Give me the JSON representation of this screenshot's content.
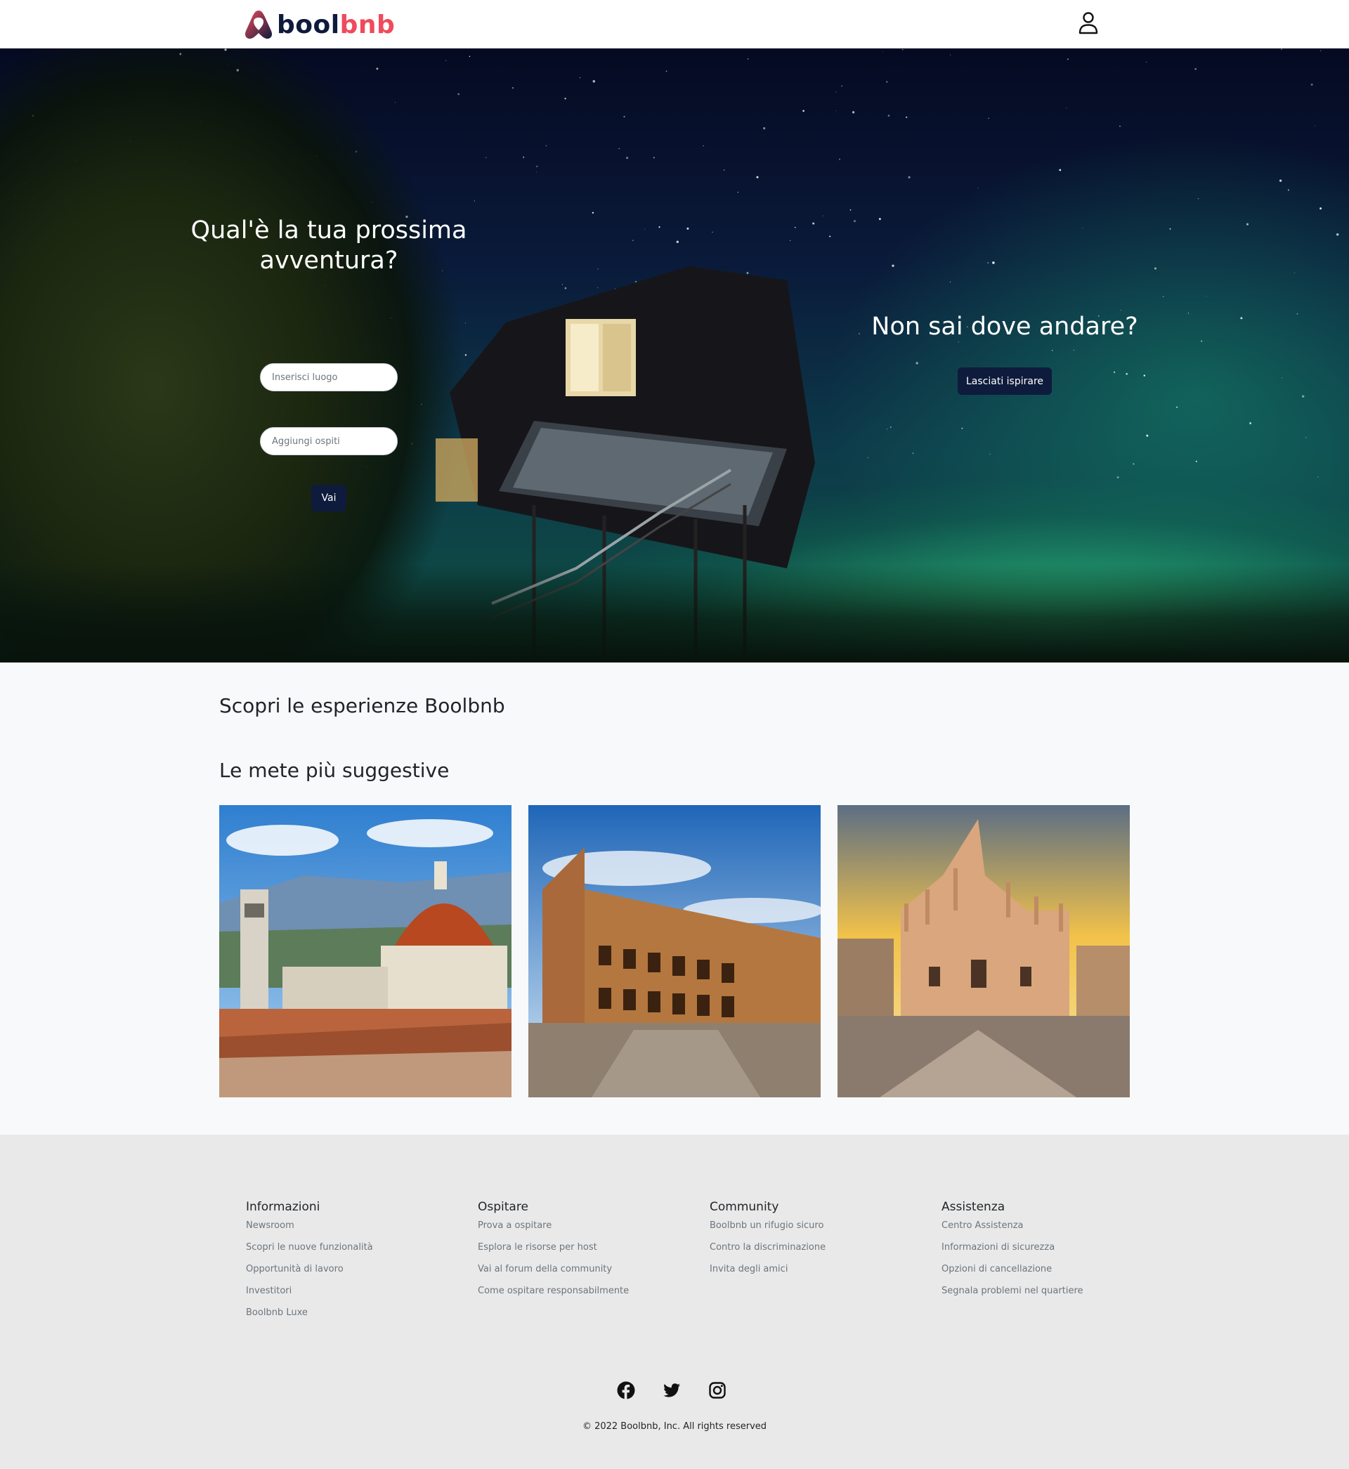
{
  "header": {
    "logo_text_dark": "bool",
    "logo_text_accent": "bnb",
    "user_icon": "user-icon"
  },
  "hero": {
    "title": "Qual'è la tua prossima avventura?",
    "place_placeholder": "Inserisci luogo",
    "guests_placeholder": "Aggiungi ospiti",
    "go_button": "Vai",
    "right_title": "Non sai dove andare?",
    "inspire_button": "Lasciati ispirare"
  },
  "main": {
    "experiences_title": "Scopri le esperienze Boolbnb",
    "destinations_title": "Le mete più suggestive",
    "cards": [
      {
        "image": "florence-duomo"
      },
      {
        "image": "rome-colosseum"
      },
      {
        "image": "milan-duomo"
      }
    ]
  },
  "footer": {
    "columns": [
      {
        "title": "Informazioni",
        "links": [
          "Newsroom",
          "Scopri le nuove funzionalità",
          "Opportunità di lavoro",
          "Investitori",
          "Boolbnb Luxe"
        ]
      },
      {
        "title": "Ospitare",
        "links": [
          "Prova a ospitare",
          "Esplora le risorse per host",
          "Vai al forum della community",
          "Come ospitare responsabilmente"
        ]
      },
      {
        "title": "Community",
        "links": [
          "Boolbnb un rifugio sicuro",
          "Contro la discriminazione",
          "Invita degli amici"
        ]
      },
      {
        "title": "Assistenza",
        "links": [
          "Centro Assistenza",
          "Informazioni di sicurezza",
          "Opzioni di cancellazione",
          "Segnala problemi nel quartiere"
        ]
      }
    ],
    "social_icons": [
      "facebook-icon",
      "twitter-icon",
      "instagram-icon"
    ],
    "copyright": "© 2022 Boolbnb, Inc. All rights reserved"
  },
  "colors": {
    "brand_dark": "#0e1b3c",
    "brand_accent": "#ef4b5c",
    "footer_bg": "#e9e9e9",
    "page_bg": "#f8f9fa"
  }
}
